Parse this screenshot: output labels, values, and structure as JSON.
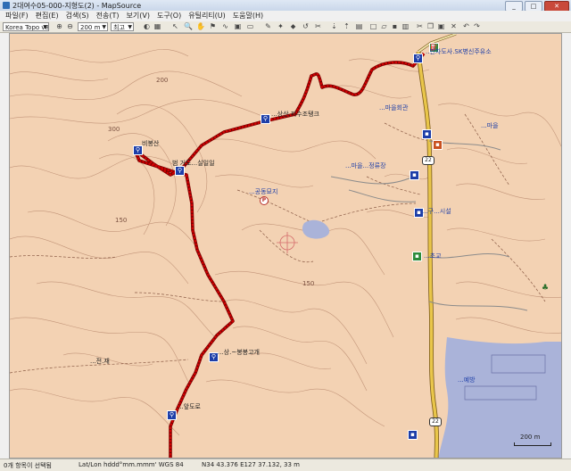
{
  "window": {
    "title": "2대여수05-000-지형도(2) - MapSource",
    "minimize": "_",
    "maximize": "□",
    "close": "✕"
  },
  "menu": [
    "파일(F)",
    "편집(E)",
    "검색(S)",
    "전송(T)",
    "보기(V)",
    "도구(O)",
    "유틸리티(U)",
    "도움말(H)"
  ],
  "toolbar": {
    "product_select": "Korea Topo v8",
    "zoom_select": "200 m",
    "detail_select": "최고",
    "icons": [
      "zoom-in-icon",
      "zoom-out-icon",
      "select-tool-icon",
      "zoom-tool-icon",
      "pan-tool-icon",
      "waypoint-tool-icon",
      "route-tool-icon",
      "track-tool-icon",
      "distance-tool-icon",
      "find-icon",
      "receive-icon",
      "send-icon",
      "new-icon",
      "open-icon",
      "save-icon",
      "print-icon",
      "cut-icon",
      "copy-icon",
      "paste-icon",
      "delete-icon",
      "undo-icon",
      "redo-icon"
    ]
  },
  "map": {
    "colors": {
      "land": "#f3d2b3",
      "contour": "#b28066",
      "track": "#c00000",
      "road": "#e9c64a",
      "water": "#aab3d9"
    },
    "labels": {
      "junction_top": "..만자도사.SK병신주유소",
      "reservoir": "...상산.저수조탱크",
      "peak": "비봉산",
      "junction_mid": "범 거도...실일일",
      "facility": "...공동묘지",
      "bus": "...마을...정류장",
      "facility2": "...구...시설",
      "pass": "...상.~봉봉고개",
      "bottom_stop": "...앞도로",
      "left_road": "...전.재",
      "port": "...예방",
      "village1": "...마을회관",
      "village2": "...마을",
      "school": "...초교",
      "contour_150a": "150",
      "contour_150b": "150",
      "contour_200": "200",
      "contour_300": "300",
      "road_22_top": "22",
      "road_22_bottom": "22",
      "scale": "200 m"
    }
  },
  "status": {
    "count": "0개 항목이 선택됨",
    "format": "Lat/Lon hddd°mm.mmm' WGS 84",
    "coords": "N34 43.376 E127 37.132, 33 m"
  }
}
